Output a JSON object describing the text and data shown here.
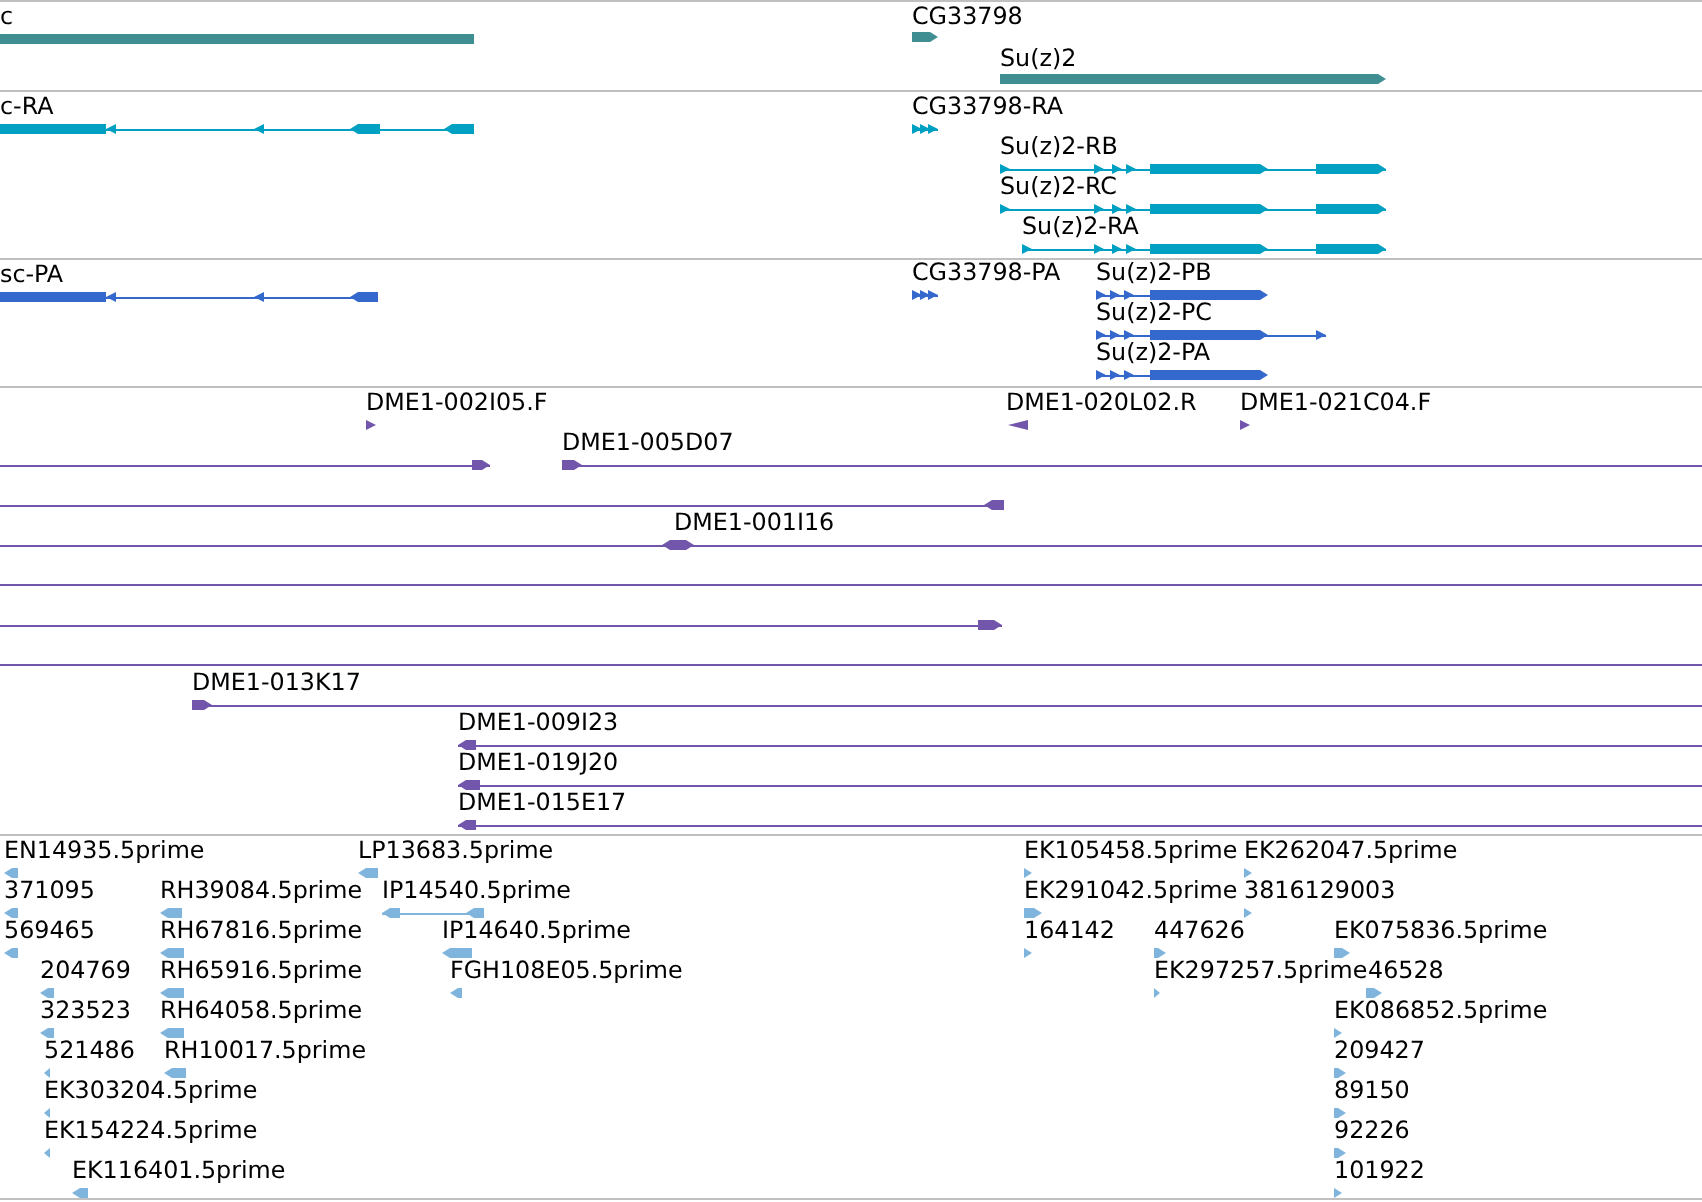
{
  "tracks": [
    {
      "kind": "gene",
      "color": "#3f8e92",
      "features": [
        {
          "label": "c",
          "reverse": true
        },
        {
          "label": "CG33798",
          "reverse": false
        },
        {
          "label": "Su(z)2",
          "reverse": false
        }
      ]
    },
    {
      "kind": "transcript",
      "color": "#00a0c2",
      "features": [
        {
          "label": "c-RA",
          "reverse": true
        },
        {
          "label": "CG33798-RA",
          "reverse": false
        },
        {
          "label": "Su(z)2-RB",
          "reverse": false
        },
        {
          "label": "Su(z)2-RC",
          "reverse": false
        },
        {
          "label": "Su(z)2-RA",
          "reverse": false
        }
      ]
    },
    {
      "kind": "protein",
      "color": "#3468cc",
      "features": [
        {
          "label": "sc-PA",
          "reverse": true
        },
        {
          "label": "CG33798-PA",
          "reverse": false
        },
        {
          "label": "Su(z)2-PB",
          "reverse": false
        },
        {
          "label": "Su(z)2-PC",
          "reverse": false
        },
        {
          "label": "Su(z)2-PA",
          "reverse": false
        }
      ]
    },
    {
      "kind": "clone",
      "color": "#7256ab",
      "features": [
        {
          "kind": "read",
          "label": "DME1-002I05.F",
          "reverse": false
        },
        {
          "kind": "read",
          "label": "DME1-020L02.R",
          "reverse": true
        },
        {
          "kind": "read",
          "label": "DME1-021C04.F",
          "reverse": false
        },
        {
          "kind": "clone",
          "reverse": false
        },
        {
          "kind": "clone",
          "label": "DME1-005D07",
          "reverse": false
        },
        {
          "kind": "clone",
          "reverse": true
        },
        {
          "kind": "clone",
          "label": "DME1-001I16"
        },
        {
          "kind": "clone"
        },
        {
          "kind": "clone",
          "reverse": false
        },
        {
          "kind": "clone"
        },
        {
          "kind": "clone",
          "label": "DME1-013K17",
          "reverse": false
        },
        {
          "kind": "clone",
          "label": "DME1-009I23",
          "reverse": true
        },
        {
          "kind": "clone",
          "label": "DME1-019J20",
          "reverse": true
        },
        {
          "kind": "clone",
          "label": "DME1-015E17",
          "reverse": true
        }
      ]
    },
    {
      "kind": "est",
      "color": "#7fb5dd",
      "features": [
        {
          "label": "EN14935.5prime",
          "reverse": true
        },
        {
          "label": "371095",
          "reverse": true
        },
        {
          "label": "569465",
          "reverse": true
        },
        {
          "label": "204769",
          "reverse": true
        },
        {
          "label": "323523",
          "reverse": true
        },
        {
          "label": "521486",
          "reverse": true
        },
        {
          "label": "EK303204.5prime",
          "reverse": true
        },
        {
          "label": "EK154224.5prime",
          "reverse": true
        },
        {
          "label": "EK116401.5prime",
          "reverse": true
        },
        {
          "label": "RH39084.5prime",
          "reverse": true
        },
        {
          "label": "RH67816.5prime",
          "reverse": true
        },
        {
          "label": "RH65916.5prime",
          "reverse": true
        },
        {
          "label": "RH64058.5prime",
          "reverse": true
        },
        {
          "label": "RH10017.5prime",
          "reverse": true
        },
        {
          "label": "LP13683.5prime",
          "reverse": true
        },
        {
          "label": "IP14540.5prime",
          "reverse": true
        },
        {
          "label": "IP14640.5prime",
          "reverse": true
        },
        {
          "label": "FGH108E05.5prime",
          "reverse": true
        },
        {
          "label": "EK105458.5prime",
          "reverse": false
        },
        {
          "label": "EK262047.5prime",
          "reverse": false
        },
        {
          "label": "EK291042.5prime",
          "reverse": false
        },
        {
          "label": "3816129003",
          "reverse": false
        },
        {
          "label": "164142",
          "reverse": false
        },
        {
          "label": "447626",
          "reverse": false
        },
        {
          "label": "EK075836.5prime",
          "reverse": false
        },
        {
          "label": "EK297257.5prime",
          "reverse": false
        },
        {
          "label": "46528",
          "reverse": false
        },
        {
          "label": "EK086852.5prime",
          "reverse": false
        },
        {
          "label": "209427",
          "reverse": false
        },
        {
          "label": "89150",
          "reverse": false
        },
        {
          "label": "92226",
          "reverse": false
        },
        {
          "label": "101922",
          "reverse": false
        }
      ]
    }
  ]
}
